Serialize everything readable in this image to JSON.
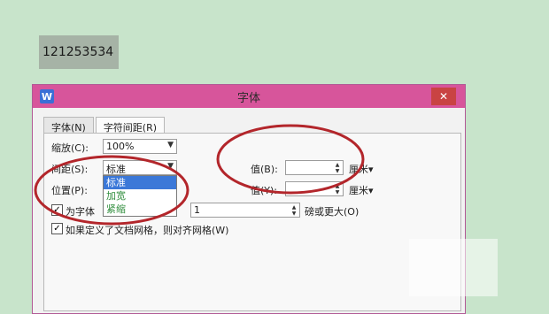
{
  "selected_text": "121253534",
  "dialog": {
    "title": "字体",
    "app_icon": "W",
    "close_glyph": "✕",
    "tabs": [
      {
        "label": "字体(N)",
        "active": false
      },
      {
        "label": "字符间距(R)",
        "active": true
      }
    ],
    "scale": {
      "label": "缩放(C):",
      "value": "100%"
    },
    "spacing": {
      "label": "间距(S):",
      "value": "标准",
      "options": [
        "标准",
        "加宽",
        "紧缩"
      ]
    },
    "position": {
      "label": "位置(P):"
    },
    "spacing_value": {
      "label": "值(B):",
      "value": "",
      "unit": "厘米▾"
    },
    "position_value": {
      "label": "值(Y):",
      "value": "",
      "unit": "厘米▾"
    },
    "kerning": {
      "label": "为字体",
      "value": "1",
      "suffix": "磅或更大(O)",
      "checked": true
    },
    "grid": {
      "label": "如果定义了文档网格，则对齐网格(W)",
      "checked": true
    }
  },
  "colors": {
    "titlebar": "#d7559b",
    "annotation": "#b3262b",
    "background": "#c8e4cb"
  }
}
